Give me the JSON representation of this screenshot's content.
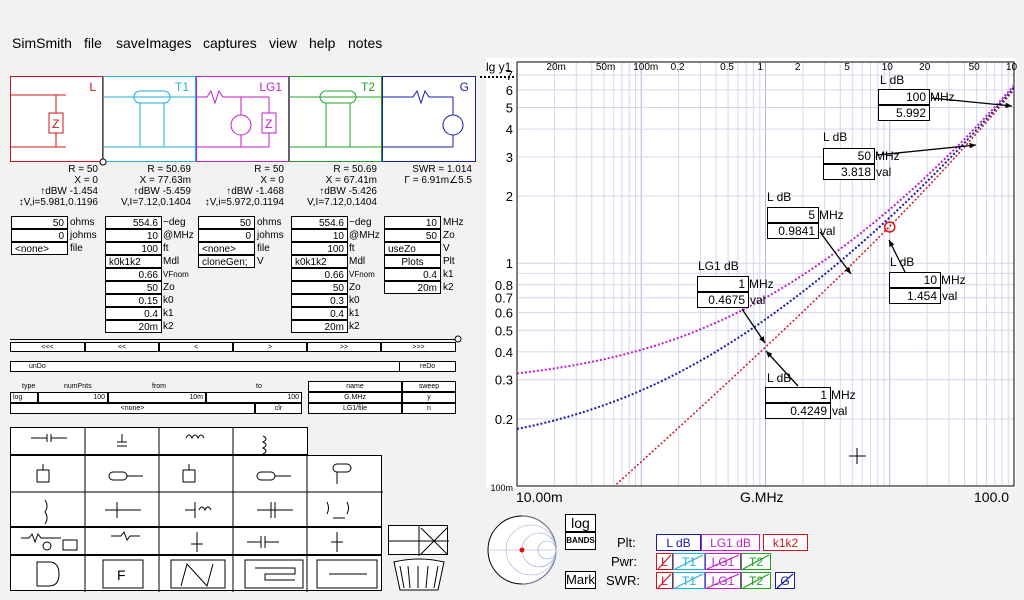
{
  "menu": [
    "SimSmith",
    "file",
    "saveImages",
    "captures",
    "view",
    "help",
    "notes"
  ],
  "components": [
    {
      "name": "L",
      "color": "#d2131e"
    },
    {
      "name": "T1",
      "color": "#1fb1d8"
    },
    {
      "name": "LG1",
      "color": "#c11ec9"
    },
    {
      "name": "T2",
      "color": "#20a020"
    },
    {
      "name": "G",
      "color": "#1a1aa8"
    }
  ],
  "readouts": {
    "L": [
      "R = 50",
      "X = 0",
      "↑dBW -1.454",
      "↕V,i=5.981,0.1196"
    ],
    "T1": [
      "R = 50.69",
      "X = 77.63m",
      "↑dBW -5.459",
      "V,I=7.12,0.1404"
    ],
    "LG1": [
      "R = 50",
      "X = 0",
      "↑dBW -1.468",
      "↕V,i=5.972,0.1194"
    ],
    "T2": [
      "R = 50.69",
      "X = 67.41m",
      "↑dBW -5.426",
      "V,I=7.12,0.1404"
    ],
    "G": [
      "SWR = 1.014",
      "Γ = 6.91m∠5.5"
    ]
  },
  "params": {
    "L": [
      {
        "v": "50",
        "u": "ohms"
      },
      {
        "v": "0",
        "u": "johms"
      },
      {
        "v": "<none>",
        "u": "file"
      }
    ],
    "T1": [
      {
        "v": "554.6",
        "u": "~deg"
      },
      {
        "v": "10",
        "u": "@MHz"
      },
      {
        "v": "100",
        "u": "ft"
      },
      {
        "v": "k0k1k2",
        "u": "Mdl"
      },
      {
        "v": "0.66",
        "u": "VFnom"
      },
      {
        "v": "50",
        "u": "Zo"
      },
      {
        "v": "0.15",
        "u": "k0"
      },
      {
        "v": "0.4",
        "u": "k1"
      },
      {
        "v": "20m",
        "u": "k2"
      }
    ],
    "LG1": [
      {
        "v": "50",
        "u": "ohms"
      },
      {
        "v": "0",
        "u": "johms"
      },
      {
        "v": "<none>",
        "u": "file"
      },
      {
        "v": "cloneGen;",
        "u": "V"
      }
    ],
    "T2": [
      {
        "v": "554.6",
        "u": "~deg"
      },
      {
        "v": "10",
        "u": "@MHz"
      },
      {
        "v": "100",
        "u": "ft"
      },
      {
        "v": "k0k1k2",
        "u": "Mdl"
      },
      {
        "v": "0.66",
        "u": "VFnom"
      },
      {
        "v": "50",
        "u": "Zo"
      },
      {
        "v": "0.3",
        "u": "k0"
      },
      {
        "v": "0.4",
        "u": "k1"
      },
      {
        "v": "20m",
        "u": "k2"
      }
    ],
    "G": [
      {
        "v": "10",
        "u": "MHz"
      },
      {
        "v": "50",
        "u": "Zo"
      },
      {
        "v": "useZo",
        "u": "V"
      },
      {
        "v": "Plots",
        "u": "Plt"
      },
      {
        "v": "0.4",
        "u": "k1"
      },
      {
        "v": "20m",
        "u": "k2"
      }
    ]
  },
  "nav": [
    "<<<",
    "<<",
    "<",
    ">",
    ">>",
    ">>>"
  ],
  "undo": "unDo",
  "redo": "reDo",
  "sweep": {
    "headers": [
      "type",
      "numPnts",
      "from",
      "to",
      "name",
      "sweep"
    ],
    "row1": [
      "log",
      "100",
      "10m",
      "100",
      "G.MHz",
      "y"
    ],
    "row2": [
      "<none>",
      "clr",
      "LG1/file",
      "n"
    ]
  },
  "chart": {
    "ytitle": "lg y1",
    "xticks": [
      "20m",
      "50m",
      "100m",
      "0.2",
      "0.5",
      "1",
      "2",
      "5",
      "10",
      "20",
      "50",
      "10"
    ],
    "yticks": [
      "7",
      "6",
      "5",
      "4",
      "3",
      "2",
      "1",
      "0.8",
      "0.7",
      "0.6",
      "0.5",
      "0.4",
      "0.3",
      "0.2",
      "100m"
    ],
    "xlabels": [
      "10.00m",
      "G.MHz",
      "100.0"
    ]
  },
  "markers": [
    {
      "title": "L dB",
      "freq": "100",
      "unit": "MHz",
      "val": "5.992",
      "vunit": "val"
    },
    {
      "title": "L dB",
      "freq": "50",
      "unit": "MHz",
      "val": "3.818",
      "vunit": "val"
    },
    {
      "title": "L dB",
      "freq": "5",
      "unit": "MHz",
      "val": "0.9841",
      "vunit": "val"
    },
    {
      "title": "LG1 dB",
      "freq": "1",
      "unit": "MHz",
      "val": "0.4675",
      "vunit": "val"
    },
    {
      "title": "L dB",
      "freq": "10",
      "unit": "MHz",
      "val": "1.454",
      "vunit": "val"
    },
    {
      "title": "L dB",
      "freq": "1",
      "unit": "MHz",
      "val": "0.4249",
      "vunit": "val"
    }
  ],
  "bottom": {
    "log": "log",
    "bands": "BANDS",
    "mark": "Mark",
    "plt": "Plt:",
    "pwr": "Pwr:",
    "swr": "SWR:",
    "plots": [
      "L dB",
      "LG1 dB",
      "k1k2"
    ],
    "pwr_items": [
      "L",
      "T1",
      "LG1",
      "T2"
    ],
    "swr_items": [
      "L",
      "T1",
      "LG1",
      "T2",
      "G"
    ]
  }
}
